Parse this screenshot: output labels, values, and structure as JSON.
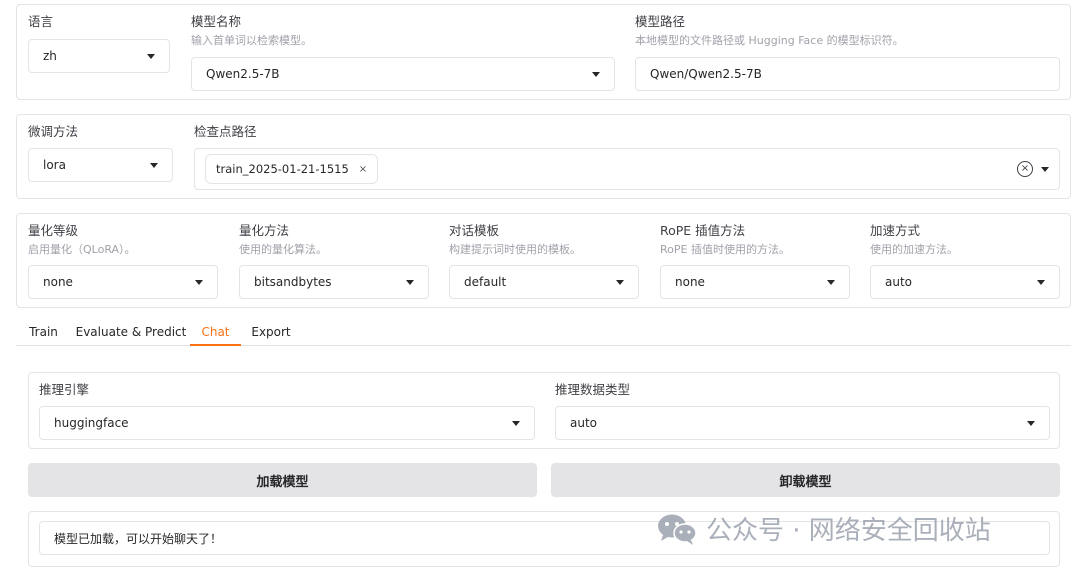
{
  "top": {
    "language": {
      "label": "语言",
      "value": "zh"
    },
    "model_name": {
      "label": "模型名称",
      "info": "输入首单词以检索模型。",
      "value": "Qwen2.5-7B"
    },
    "model_path": {
      "label": "模型路径",
      "info": "本地模型的文件路径或 Hugging Face 的模型标识符。",
      "value": "Qwen/Qwen2.5-7B"
    }
  },
  "finetune": {
    "method": {
      "label": "微调方法",
      "value": "lora"
    },
    "checkpoint": {
      "label": "检查点路径",
      "chips": [
        "train_2025-01-21-1515"
      ],
      "chip_close": "×",
      "clear": "×"
    }
  },
  "quant": {
    "bit": {
      "label": "量化等级",
      "info": "启用量化（QLoRA）。",
      "value": "none"
    },
    "method": {
      "label": "量化方法",
      "info": "使用的量化算法。",
      "value": "bitsandbytes"
    },
    "template": {
      "label": "对话模板",
      "info": "构建提示词时使用的模板。",
      "value": "default"
    },
    "rope": {
      "label": "RoPE 插值方法",
      "info": "RoPE 插值时使用的方法。",
      "value": "none"
    },
    "booster": {
      "label": "加速方式",
      "info": "使用的加速方法。",
      "value": "auto"
    }
  },
  "tabs": [
    {
      "label": "Train"
    },
    {
      "label": "Evaluate & Predict"
    },
    {
      "label": "Chat",
      "active": true
    },
    {
      "label": "Export"
    }
  ],
  "chat": {
    "infer_backend": {
      "label": "推理引擎",
      "value": "huggingface"
    },
    "infer_dtype": {
      "label": "推理数据类型",
      "value": "auto"
    },
    "load_button": "加载模型",
    "unload_button": "卸载模型",
    "info_box": "模型已加载，可以开始聊天了！"
  },
  "watermark": {
    "text": "公众号 · 网络安全回收站",
    "icon": "wechat-icon"
  },
  "colors": {
    "accent": "#f97316",
    "border": "#e4e4e7",
    "button_bg": "#e4e4e7",
    "muted": "#a1a1aa"
  }
}
